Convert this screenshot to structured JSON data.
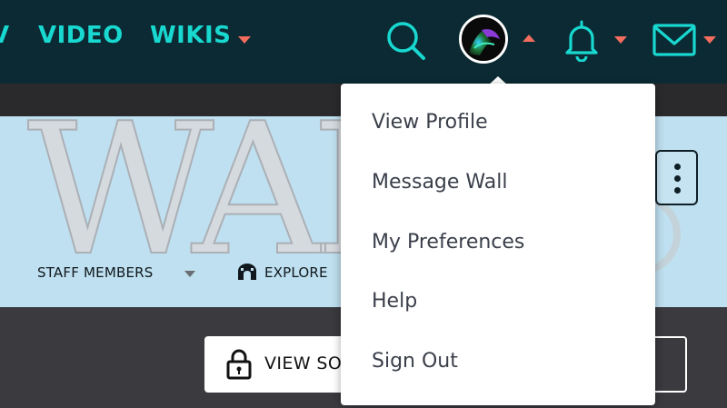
{
  "topnav": {
    "links": [
      {
        "label": "V"
      },
      {
        "label": "VIDEO"
      },
      {
        "label": "WIKIS"
      }
    ],
    "icons": [
      "search-icon",
      "avatar",
      "bell-icon",
      "envelope-icon"
    ]
  },
  "banner": {
    "wordmark": "WAR",
    "local_nav": [
      {
        "label": "STAFF MEMBERS"
      },
      {
        "label": "EXPLORE"
      }
    ]
  },
  "actions": {
    "view_source_label": "VIEW SO"
  },
  "user_menu": {
    "items": [
      {
        "label": "View Profile"
      },
      {
        "label": "Message Wall"
      },
      {
        "label": "My Preferences"
      },
      {
        "label": "Help"
      },
      {
        "label": "Sign Out"
      }
    ]
  },
  "colors": {
    "nav_bg": "#0b2a33",
    "nav_accent": "#18d8d0",
    "caret": "#f36d5f",
    "banner_bg": "#bfe0f0",
    "content_bg": "#3a3a3f"
  }
}
